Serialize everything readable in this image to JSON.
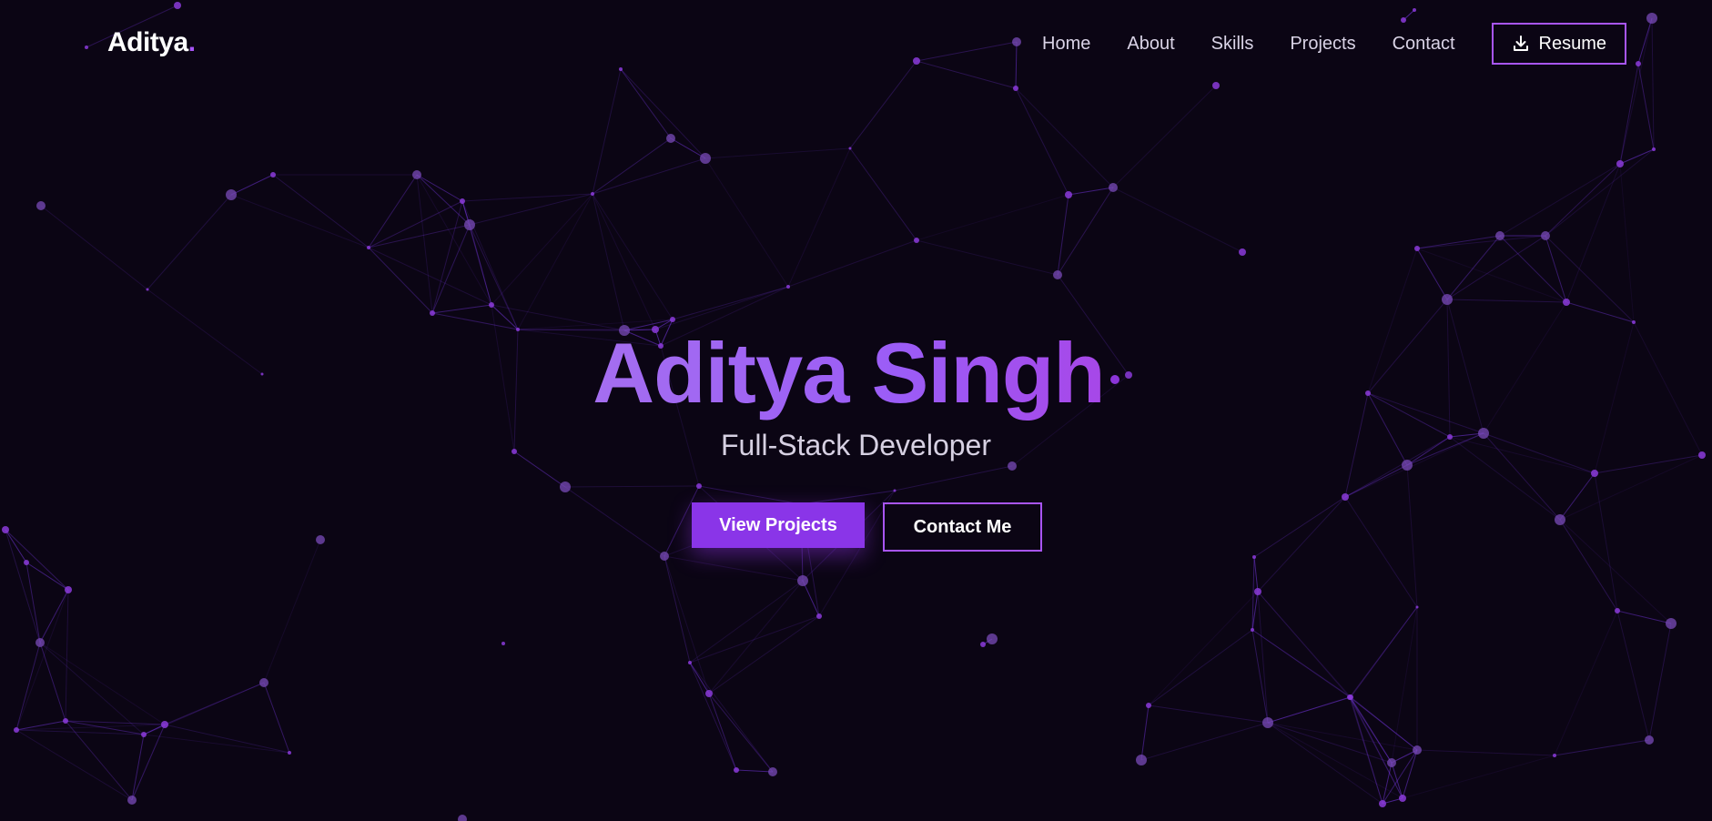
{
  "brand": {
    "name": "Aditya",
    "accent_dot": ".",
    "accent_color": "#a855f7"
  },
  "nav": {
    "links": [
      "Home",
      "About",
      "Skills",
      "Projects",
      "Contact"
    ],
    "resume_label": "Resume",
    "resume_icon": "download-icon"
  },
  "hero": {
    "title": "Aditya Singh",
    "subtitle": "Full-Stack Developer",
    "primary_cta": "View Projects",
    "secondary_cta": "Contact Me"
  },
  "colors": {
    "background": "#0b0514",
    "accent": "#a855f7",
    "button_primary": "#8a35e8",
    "network": "#8b5cf6"
  }
}
